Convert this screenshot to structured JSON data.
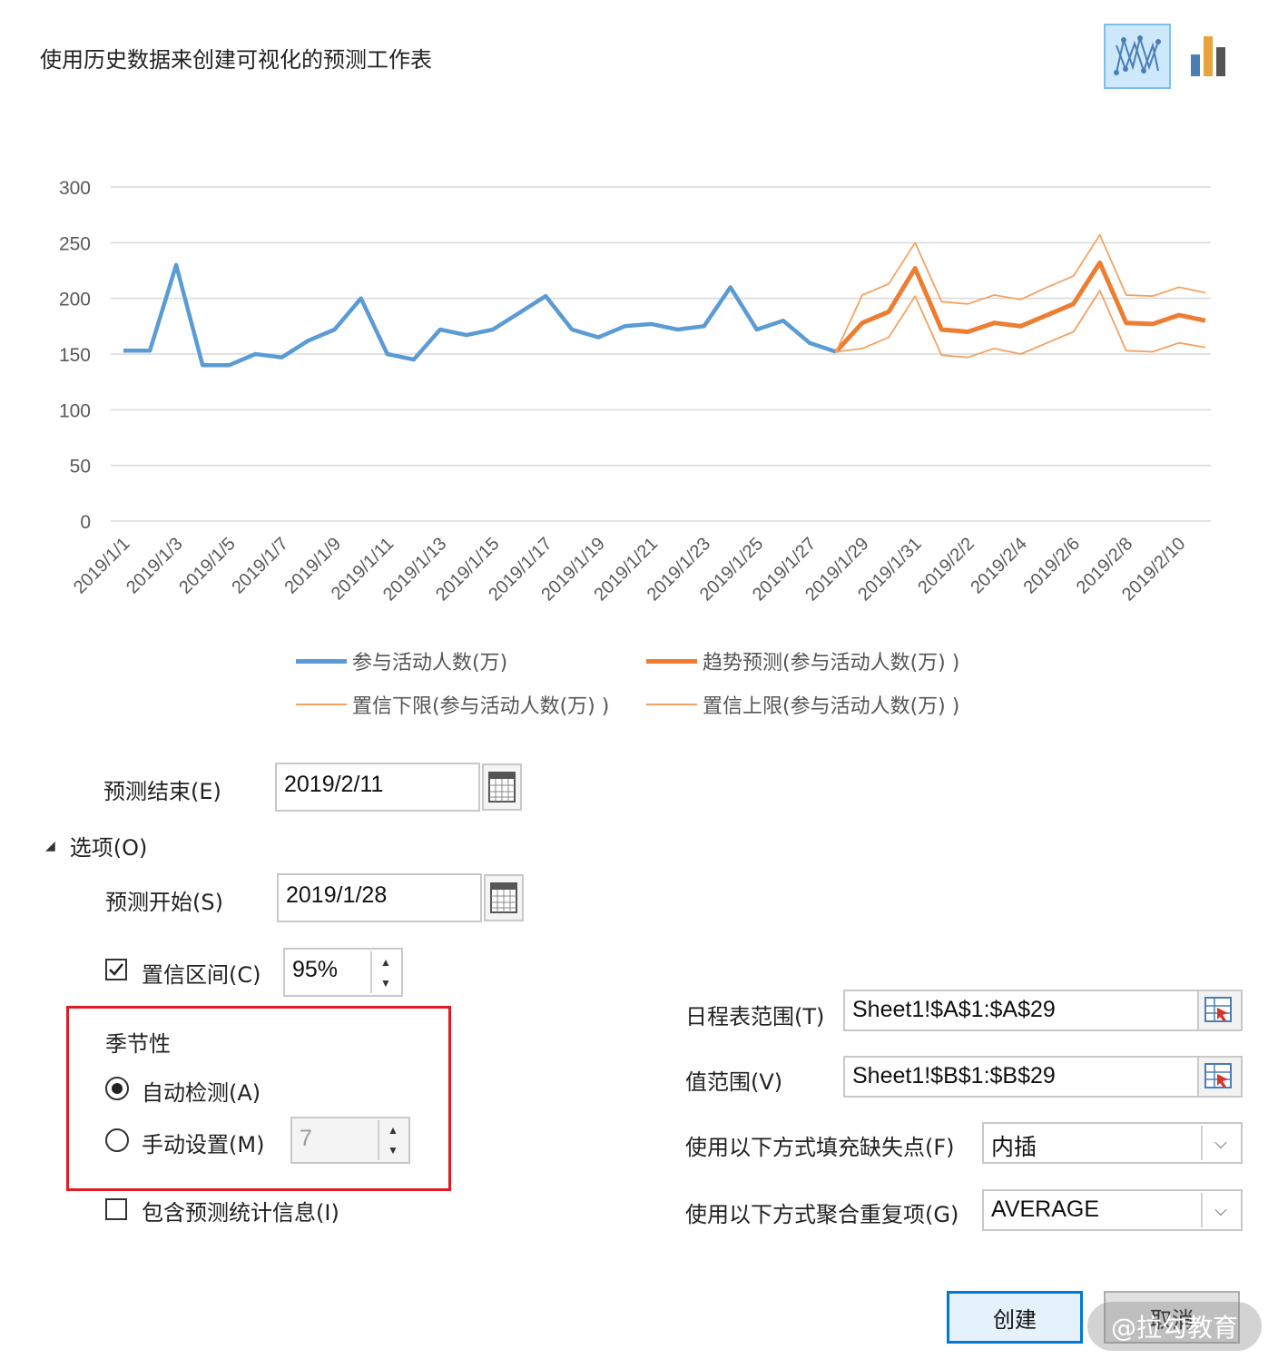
{
  "dialog": {
    "title": "使用历史数据来创建可视化的预测工作表",
    "chart_type_buttons": [
      {
        "name": "line-chart-icon",
        "selected": true
      },
      {
        "name": "bar-chart-icon",
        "selected": false
      }
    ]
  },
  "chart_data": {
    "type": "line",
    "ylim": [
      0,
      300
    ],
    "yticks": [
      "300",
      "250",
      "200",
      "150",
      "100",
      "50",
      "0"
    ],
    "x": [
      "2019/1/1",
      "2019/1/2",
      "2019/1/3",
      "2019/1/4",
      "2019/1/5",
      "2019/1/6",
      "2019/1/7",
      "2019/1/8",
      "2019/1/9",
      "2019/1/10",
      "2019/1/11",
      "2019/1/12",
      "2019/1/13",
      "2019/1/14",
      "2019/1/15",
      "2019/1/16",
      "2019/1/17",
      "2019/1/18",
      "2019/1/19",
      "2019/1/20",
      "2019/1/21",
      "2019/1/22",
      "2019/1/23",
      "2019/1/24",
      "2019/1/25",
      "2019/1/26",
      "2019/1/27",
      "2019/1/28",
      "2019/1/29",
      "2019/1/30",
      "2019/1/31",
      "2019/2/1",
      "2019/2/2",
      "2019/2/3",
      "2019/2/4",
      "2019/2/5",
      "2019/2/6",
      "2019/2/7",
      "2019/2/8",
      "2019/2/9",
      "2019/2/10",
      "2019/2/11"
    ],
    "xticks": [
      "2019/1/1",
      "2019/1/3",
      "2019/1/5",
      "2019/1/7",
      "2019/1/9",
      "2019/1/11",
      "2019/1/13",
      "2019/1/15",
      "2019/1/17",
      "2019/1/19",
      "2019/1/21",
      "2019/1/23",
      "2019/1/25",
      "2019/1/27",
      "2019/1/29",
      "2019/1/31",
      "2019/2/2",
      "2019/2/4",
      "2019/2/6",
      "2019/2/8",
      "2019/2/10"
    ],
    "series": [
      {
        "name": "参与活动人数(万)",
        "color": "#5b9bd5",
        "style": "actual",
        "start_index": 0,
        "values": [
          153,
          153,
          230,
          140,
          140,
          150,
          147,
          162,
          172,
          200,
          150,
          145,
          172,
          167,
          172,
          187,
          202,
          172,
          165,
          175,
          177,
          172,
          175,
          210,
          172,
          180,
          160,
          152
        ]
      },
      {
        "name": "趋势预测(参与活动人数(万))",
        "color": "#ed7d31",
        "style": "forecast",
        "start_index": 27,
        "values": [
          152,
          178,
          188,
          227,
          172,
          170,
          178,
          175,
          185,
          195,
          232,
          178,
          177,
          185,
          180
        ]
      },
      {
        "name": "置信下限(参与活动人数(万))",
        "color": "#f4a261",
        "style": "bound",
        "start_index": 27,
        "values": [
          152,
          155,
          165,
          202,
          149,
          147,
          155,
          150,
          160,
          170,
          207,
          153,
          152,
          160,
          156
        ]
      },
      {
        "name": "置信上限(参与活动人数(万))",
        "color": "#f4a261",
        "style": "bound",
        "start_index": 27,
        "values": [
          152,
          203,
          213,
          250,
          197,
          195,
          203,
          199,
          210,
          220,
          257,
          203,
          202,
          210,
          205
        ]
      }
    ]
  },
  "legend": [
    {
      "label": "参与活动人数(万)",
      "color": "#5b9bd5",
      "style": "actual"
    },
    {
      "label": "趋势预测(参与活动人数(万) )",
      "color": "#ed7d31",
      "style": "forecast"
    },
    {
      "label": "置信下限(参与活动人数(万) )",
      "color": "#f4a261",
      "style": "bound"
    },
    {
      "label": "置信上限(参与活动人数(万) )",
      "color": "#f4a261",
      "style": "bound"
    }
  ],
  "forecast_end": {
    "label": "预测结束(E)",
    "value": "2019/2/11"
  },
  "options": {
    "toggle_label": "选项(O)",
    "forecast_start": {
      "label": "预测开始(S)",
      "value": "2019/1/28"
    },
    "confidence": {
      "label": "置信区间(C)",
      "checked": true,
      "value": "95%"
    },
    "seasonality": {
      "title": "季节性",
      "auto": {
        "label": "自动检测(A)",
        "selected": true
      },
      "manual": {
        "label": "手动设置(M)",
        "selected": false,
        "value": "7"
      }
    },
    "include_stats": {
      "label": "包含预测统计信息(I)",
      "checked": false
    },
    "timeline_range": {
      "label": "日程表范围(T)",
      "value": "Sheet1!$A$1:$A$29"
    },
    "values_range": {
      "label": "值范围(V)",
      "value": "Sheet1!$B$1:$B$29"
    },
    "fill_missing": {
      "label": "使用以下方式填充缺失点(F)",
      "value": "内插"
    },
    "aggregate": {
      "label": "使用以下方式聚合重复项(G)",
      "value": "AVERAGE"
    }
  },
  "buttons": {
    "create": "创建",
    "cancel": "取消"
  },
  "watermark": "@拉勾教育"
}
